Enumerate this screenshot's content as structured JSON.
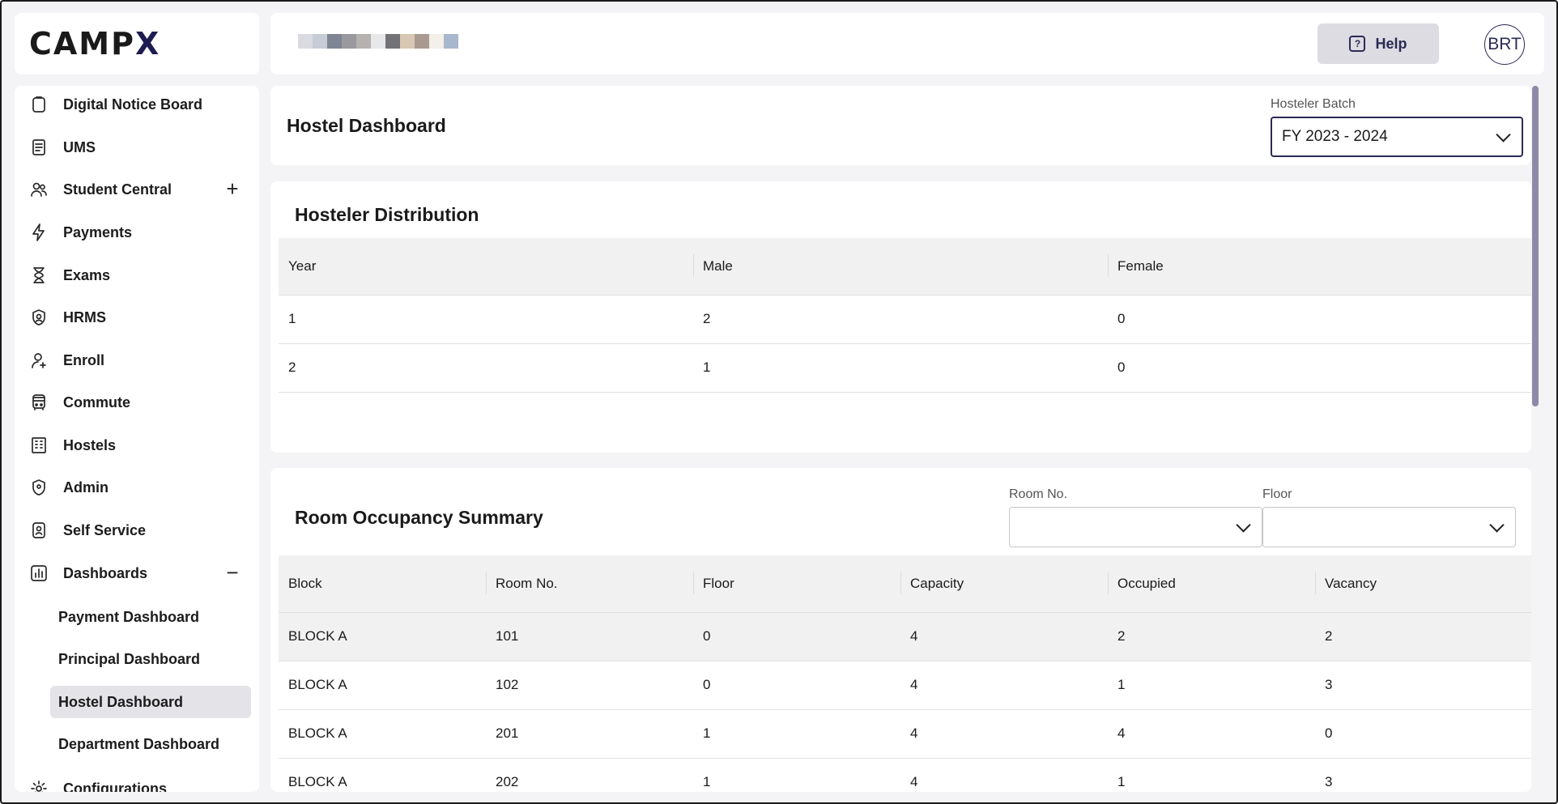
{
  "brand": {
    "logo_text": "CAMP",
    "logo_x": "X"
  },
  "header": {
    "help_label": "Help",
    "avatar_initials": "BRT",
    "masked_colors": [
      "#d9dbe0",
      "#c7ccd6",
      "#7f8593",
      "#9a9a9e",
      "#b5b2b0",
      "#e8e8ea",
      "#737377",
      "#d8c7b3",
      "#a99a91",
      "#f3efe9",
      "#a8b8cc"
    ]
  },
  "sidebar": {
    "items": [
      {
        "label": "Digital Notice Board",
        "icon": "clipboard-icon"
      },
      {
        "label": "UMS",
        "icon": "document-icon"
      },
      {
        "label": "Student Central",
        "icon": "users-icon",
        "toggle": "+"
      },
      {
        "label": "Payments",
        "icon": "lightning-icon"
      },
      {
        "label": "Exams",
        "icon": "hourglass-icon"
      },
      {
        "label": "HRMS",
        "icon": "badge-icon"
      },
      {
        "label": "Enroll",
        "icon": "user-plus-icon"
      },
      {
        "label": "Commute",
        "icon": "bus-icon"
      },
      {
        "label": "Hostels",
        "icon": "building-icon"
      },
      {
        "label": "Admin",
        "icon": "shield-icon"
      },
      {
        "label": "Self Service",
        "icon": "id-badge-icon"
      },
      {
        "label": "Dashboards",
        "icon": "chart-icon",
        "toggle": "−"
      }
    ],
    "sub_items": [
      "Payment Dashboard",
      "Principal Dashboard",
      "Hostel Dashboard",
      "Department Dashboard"
    ],
    "active_sub": "Hostel Dashboard",
    "last_item": {
      "label": "Configurations",
      "icon": "gear-icon"
    }
  },
  "dashboard": {
    "title": "Hostel Dashboard",
    "batch_label": "Hosteler Batch",
    "batch_value": "FY 2023 - 2024"
  },
  "distribution": {
    "title": "Hosteler Distribution",
    "columns": [
      "Year",
      "Male",
      "Female"
    ],
    "rows": [
      [
        "1",
        "2",
        "0"
      ],
      [
        "2",
        "1",
        "0"
      ]
    ]
  },
  "occupancy": {
    "title": "Room Occupancy Summary",
    "room_label": "Room No.",
    "room_value": "",
    "floor_label": "Floor",
    "floor_value": "",
    "columns": [
      "Block",
      "Room No.",
      "Floor",
      "Capacity",
      "Occupied",
      "Vacancy"
    ],
    "rows": [
      [
        "BLOCK A",
        "101",
        "0",
        "4",
        "2",
        "2"
      ],
      [
        "BLOCK A",
        "102",
        "0",
        "4",
        "1",
        "3"
      ],
      [
        "BLOCK A",
        "201",
        "1",
        "4",
        "4",
        "0"
      ],
      [
        "BLOCK A",
        "202",
        "1",
        "4",
        "1",
        "3"
      ]
    ]
  }
}
